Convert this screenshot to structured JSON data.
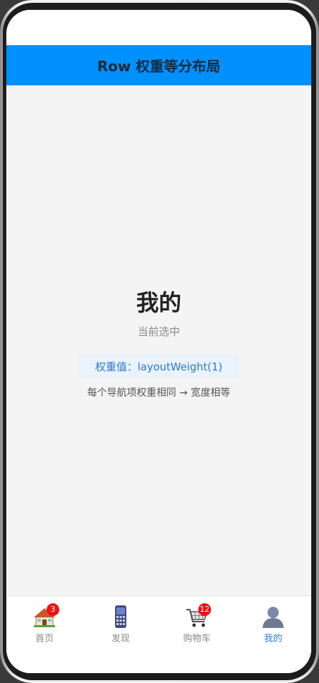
{
  "header": {
    "title": "Row 权重等分布局"
  },
  "main": {
    "title": "我的",
    "subtitle": "当前选中",
    "weight_label": "权重值：layoutWeight(1)",
    "note": "每个导航项权重相同 → 宽度相等"
  },
  "tabs": [
    {
      "label": "首页",
      "icon": "house-icon",
      "badge": "3",
      "active": false
    },
    {
      "label": "发现",
      "icon": "phone-icon",
      "badge": "",
      "active": false
    },
    {
      "label": "购物车",
      "icon": "cart-icon",
      "badge": "12",
      "active": false
    },
    {
      "label": "我的",
      "icon": "user-icon",
      "badge": "",
      "active": true
    }
  ],
  "colors": {
    "title_bar": "#0091ff",
    "active_tab": "#2c7cd2",
    "badge": "#ee1111"
  }
}
